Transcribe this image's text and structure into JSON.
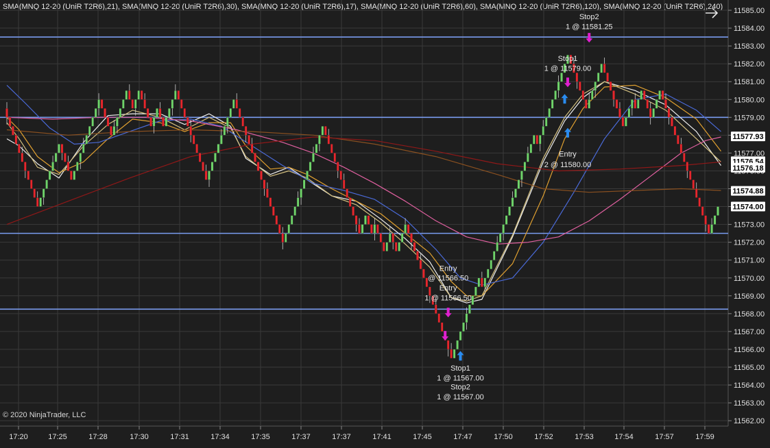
{
  "header": {
    "indicators": "SMA(MNQ 12-20 (UniR T2R6),21), SMA(MNQ 12-20 (UniR T2R6),30), SMA(MNQ 12-20 (UniR T2R6),17), SMA(MNQ 12-20 (UniR T2R6),60), SMA(MNQ 12-20 (UniR T2R6),120), SMA(MNQ 12-20 (UniR T2R6),240)"
  },
  "footer": {
    "copyright": "© 2020 NinjaTrader, LLC"
  },
  "icons": {
    "nav": "arrow-right-icon"
  },
  "colors": {
    "background": "#1e1e1e",
    "grid": "#3a3a3a",
    "up": "#6fd46a",
    "down": "#e8262c",
    "level_line": "#7a9cf0",
    "buy_arrow": "#2a8cf0",
    "sell_arrow": "#e020d0",
    "sma21": "#f0f0f0",
    "sma30": "#e0a030",
    "sma17": "#d4c080",
    "sma60": "#4a6ad8",
    "sma120": "#e060a0",
    "sma240": "#8a5020",
    "sma_long": "#901818"
  },
  "chart_data": {
    "type": "candlestick",
    "instrument": "MNQ 12-20 (UniR T2R6)",
    "y_axis": {
      "min": 11561.5,
      "max": 11585.5,
      "tick_step": 1,
      "tick_labels": [
        "11562.00",
        "11563.00",
        "11564.00",
        "11565.00",
        "11566.00",
        "11567.00",
        "11568.00",
        "11569.00",
        "11570.00",
        "11571.00",
        "11572.00",
        "11573.00",
        "11574.00",
        "11575.00",
        "11576.00",
        "11577.00",
        "11578.00",
        "11579.00",
        "11580.00",
        "11581.00",
        "11582.00",
        "11583.00",
        "11584.00",
        "11585.00"
      ]
    },
    "x_axis": {
      "tick_labels": [
        "17:20",
        "17:25",
        "17:28",
        "17:30",
        "17:31",
        "17:34",
        "17:35",
        "17:37",
        "17:37",
        "17:41",
        "17:45",
        "17:47",
        "17:50",
        "17:52",
        "17:53",
        "17:54",
        "17:57",
        "17:59"
      ]
    },
    "grid": true,
    "horizontal_lines": [
      11583.5,
      11579.0,
      11572.5,
      11568.25
    ],
    "price_markers": [
      {
        "label": "11577.93",
        "value": 11577.93,
        "bg": "#ffffff",
        "fg": "#000000"
      },
      {
        "label": "11576.54",
        "value": 11576.54,
        "bg": "#ffffff",
        "fg": "#000000"
      },
      {
        "label": "11576.18",
        "value": 11576.18,
        "bg": "#ffffff",
        "fg": "#000000"
      },
      {
        "label": "11574.88",
        "value": 11574.88,
        "bg": "#ffffff",
        "fg": "#000000"
      },
      {
        "label": "11574.00",
        "value": 11574.0,
        "bg": "#ffffff",
        "fg": "#000000"
      }
    ],
    "closes": [
      11579,
      11578.5,
      11578,
      11577.5,
      11577,
      11576.5,
      11576,
      11575.5,
      11575,
      11574.5,
      11574,
      11574.5,
      11575,
      11575.5,
      11576,
      11576.5,
      11577,
      11577.5,
      11577,
      11576.5,
      11576,
      11575.5,
      11576,
      11576.5,
      11577,
      11577.5,
      11578,
      11578.5,
      11579,
      11579.5,
      11580,
      11579.5,
      11579,
      11578.5,
      11578,
      11578.5,
      11579,
      11579.5,
      11580,
      11580.5,
      11580,
      11579.5,
      11580,
      11580.5,
      11580,
      11579.5,
      11579,
      11578.5,
      11579,
      11579.5,
      11579,
      11578.5,
      11579,
      11579.5,
      11580,
      11580.5,
      11580,
      11579.5,
      11579,
      11578.5,
      11578,
      11577.5,
      11577,
      11576.5,
      11576,
      11575.5,
      11576,
      11576.5,
      11577,
      11577.5,
      11578,
      11578.5,
      11579,
      11579.5,
      11580,
      11579.5,
      11579,
      11578.5,
      11578,
      11577.5,
      11577,
      11576.5,
      11576,
      11575.5,
      11575,
      11574.5,
      11574,
      11573.5,
      11573,
      11572.5,
      11572,
      11572.5,
      11573,
      11573.5,
      11574,
      11574.5,
      11575,
      11575.5,
      11576,
      11576.5,
      11577,
      11577.5,
      11578,
      11578.5,
      11578,
      11577.5,
      11577,
      11576.5,
      11576,
      11575.5,
      11575,
      11574.5,
      11574,
      11573.5,
      11573,
      11572.5,
      11573,
      11573.5,
      11573,
      11572.5,
      11573,
      11572.5,
      11572,
      11571.5,
      11572,
      11572.5,
      11572,
      11571.5,
      11572,
      11572.5,
      11573,
      11572.5,
      11572,
      11571.5,
      11571,
      11570.5,
      11570,
      11569.5,
      11569,
      11568.5,
      11568,
      11567.5,
      11567,
      11566.5,
      11566,
      11565.5,
      11566,
      11566.5,
      11567,
      11567.5,
      11568,
      11568.5,
      11569,
      11569.5,
      11570,
      11569.5,
      11570,
      11570.5,
      11571,
      11571.5,
      11572,
      11572.5,
      11573,
      11573.5,
      11574,
      11574.5,
      11575,
      11575.5,
      11576,
      11576.5,
      11577,
      11577.5,
      11578,
      11577.5,
      11578,
      11578.5,
      11579,
      11579.5,
      11580,
      11580.5,
      11581,
      11581.5,
      11582,
      11582.5,
      11582,
      11581.5,
      11581,
      11580.5,
      11580,
      11579.5,
      11580,
      11580.5,
      11581,
      11581.5,
      11582,
      11581.5,
      11581,
      11580.5,
      11580,
      11579.5,
      11579,
      11578.5,
      11579,
      11579.5,
      11580,
      11579.5,
      11580,
      11580.5,
      11580,
      11579.5,
      11579,
      11579.5,
      11580,
      11580.5,
      11580,
      11579.5,
      11579,
      11578.5,
      11578,
      11577.5,
      11577,
      11576.5,
      11576,
      11575.5,
      11575,
      11574.5,
      11574,
      11573.5,
      11573,
      11572.5,
      11573,
      11573.5,
      11574
    ],
    "series": [
      {
        "name": "SMA(MNQ 12-20 (UniR T2R6),21)",
        "color": "#f0f0f0",
        "x": [
          0,
          4,
          10,
          17,
          25,
          33,
          41,
          50,
          58,
          66,
          73,
          78,
          86,
          92,
          98,
          106,
          114,
          122,
          130,
          138,
          145,
          150,
          155,
          165,
          175,
          182,
          188,
          195,
          205,
          215,
          225,
          233
        ],
        "values": [
          11577.8,
          11577.4,
          11576.4,
          11575.6,
          11577.6,
          11579.1,
          11579.2,
          11579.2,
          11578.6,
          11579.2,
          11578.5,
          11576.7,
          11575.8,
          11576.2,
          11575.5,
          11574.6,
          11574.3,
          11573.3,
          11572.2,
          11570.9,
          11568.9,
          11568.6,
          11568.8,
          11572.3,
          11576.5,
          11578.8,
          11580.1,
          11581.0,
          11580.5,
          11579.7,
          11578.2,
          11576.3
        ]
      },
      {
        "name": "SMA(MNQ 12-20 (UniR T2R6),30)",
        "color": "#e0a030",
        "x": [
          0,
          4,
          10,
          17,
          25,
          33,
          41,
          50,
          58,
          66,
          73,
          78,
          86,
          92,
          98,
          106,
          114,
          122,
          130,
          138,
          145,
          150,
          155,
          165,
          175,
          182,
          188,
          195,
          205,
          215,
          225,
          233
        ],
        "values": [
          11579.0,
          11578.3,
          11576.8,
          11575.9,
          11576.5,
          11577.8,
          11578.9,
          11578.7,
          11578.2,
          11578.7,
          11578.7,
          11577.4,
          11576.1,
          11576.2,
          11575.8,
          11575.0,
          11574.3,
          11573.6,
          11572.5,
          11571.4,
          11569.8,
          11569.0,
          11569.0,
          11570.8,
          11574.6,
          11577.8,
          11579.5,
          11580.7,
          11580.8,
          11580.1,
          11578.9,
          11577.1
        ]
      },
      {
        "name": "SMA(MNQ 12-20 (UniR T2R6),17)",
        "color": "#d4c080",
        "x": [
          0,
          4,
          10,
          17,
          25,
          33,
          41,
          50,
          58,
          66,
          73,
          78,
          86,
          92,
          98,
          106,
          114,
          122,
          130,
          138,
          145,
          150,
          155,
          165,
          175,
          182,
          188,
          195,
          205,
          215,
          225,
          233
        ],
        "values": [
          11578.7,
          11577.8,
          11576.2,
          11575.8,
          11577.4,
          11578.6,
          11579.4,
          11579.0,
          11578.3,
          11579.0,
          11578.4,
          11576.8,
          11575.7,
          11576.0,
          11575.6,
          11574.6,
          11574.1,
          11573.1,
          11571.9,
          11570.6,
          11568.9,
          11568.7,
          11569.0,
          11572.4,
          11576.7,
          11579.0,
          11580.3,
          11581.0,
          11580.3,
          11579.4,
          11577.8,
          11576.5
        ]
      },
      {
        "name": "SMA(MNQ 12-20 (UniR T2R6),60)",
        "color": "#4a6ad8",
        "x": [
          0,
          6,
          14,
          22,
          30,
          40,
          50,
          60,
          70,
          80,
          90,
          100,
          110,
          120,
          130,
          140,
          148,
          155,
          165,
          175,
          185,
          195,
          205,
          215,
          225,
          233
        ],
        "values": [
          11580.8,
          11579.8,
          11578.4,
          11577.5,
          11577.6,
          11578.2,
          11578.8,
          11578.9,
          11578.5,
          11577.4,
          11576.3,
          11575.3,
          11574.9,
          11574.4,
          11573.3,
          11571.6,
          11570.0,
          11569.6,
          11570.0,
          11572.0,
          11574.8,
          11577.8,
          11580.0,
          11580.3,
          11579.4,
          11578.2
        ]
      },
      {
        "name": "SMA(MNQ 12-20 (UniR T2R6),120)",
        "color": "#e060a0",
        "x": [
          0,
          15,
          30,
          45,
          60,
          75,
          90,
          100,
          110,
          120,
          130,
          140,
          150,
          160,
          170,
          180,
          190,
          200,
          210,
          220,
          228,
          233
        ],
        "values": [
          11579.0,
          11578.9,
          11579.0,
          11579.0,
          11578.8,
          11578.3,
          11577.6,
          11577.0,
          11576.2,
          11575.3,
          11574.3,
          11573.2,
          11572.3,
          11571.9,
          11572.0,
          11572.3,
          11573.2,
          11574.4,
          11575.7,
          11577.0,
          11577.7,
          11577.9
        ]
      },
      {
        "name": "SMA(MNQ 12-20 (UniR T2R6),240)",
        "color": "#8a5020",
        "x": [
          0,
          20,
          40,
          60,
          80,
          100,
          120,
          140,
          160,
          175,
          190,
          205,
          220,
          233
        ],
        "values": [
          11578.3,
          11578.0,
          11578.2,
          11578.3,
          11578.2,
          11578.0,
          11577.5,
          11576.8,
          11575.8,
          11575.0,
          11574.8,
          11574.9,
          11575.0,
          11574.9
        ]
      },
      {
        "name": "SMA",
        "color": "#901818",
        "x": [
          0,
          20,
          40,
          60,
          80,
          100,
          120,
          140,
          160,
          180,
          200,
          220,
          233
        ],
        "values": [
          11573.0,
          11574.3,
          11575.6,
          11576.8,
          11577.5,
          11577.9,
          11577.7,
          11577.1,
          11576.4,
          11576.0,
          11576.1,
          11576.3,
          11576.5
        ]
      }
    ],
    "annotations": [
      {
        "text": "Stop2",
        "value": 11584.5,
        "x": 190
      },
      {
        "text": "1 @ 11581.25",
        "value": 11583.95,
        "x": 190
      },
      {
        "text": "Stop1",
        "value": 11582.15,
        "x": 183
      },
      {
        "text": "1 @ 11579.00",
        "value": 11581.6,
        "x": 183
      },
      {
        "text": "Entry",
        "value": 11576.8,
        "x": 183
      },
      {
        "text": "2 @ 11580.00",
        "value": 11576.2,
        "x": 183
      },
      {
        "text": "Entry",
        "value": 11570.4,
        "x": 144
      },
      {
        "text": "@ 11566.50",
        "value": 11569.85,
        "x": 144
      },
      {
        "text": "Entry",
        "value": 11569.3,
        "x": 144
      },
      {
        "text": "1 @ 11566.50",
        "value": 11568.75,
        "x": 144
      },
      {
        "text": "Stop1",
        "value": 11564.8,
        "x": 148
      },
      {
        "text": "1 @ 11567.00",
        "value": 11564.25,
        "x": 148
      },
      {
        "text": "Stop2",
        "value": 11563.75,
        "x": 148
      },
      {
        "text": "1 @ 11567.00",
        "value": 11563.2,
        "x": 148
      }
    ],
    "trade_arrows": [
      {
        "type": "sell",
        "x": 190,
        "value": 11583.5
      },
      {
        "type": "sell",
        "x": 183,
        "value": 11581.0
      },
      {
        "type": "buy",
        "x": 183,
        "value": 11578.1
      },
      {
        "type": "sell",
        "x": 144,
        "value": 11568.1
      },
      {
        "type": "buy",
        "x": 148,
        "value": 11565.6
      },
      {
        "type": "sell",
        "x": 143,
        "value": 11566.8
      },
      {
        "type": "buy",
        "x": 182,
        "value": 11580.0
      }
    ]
  }
}
